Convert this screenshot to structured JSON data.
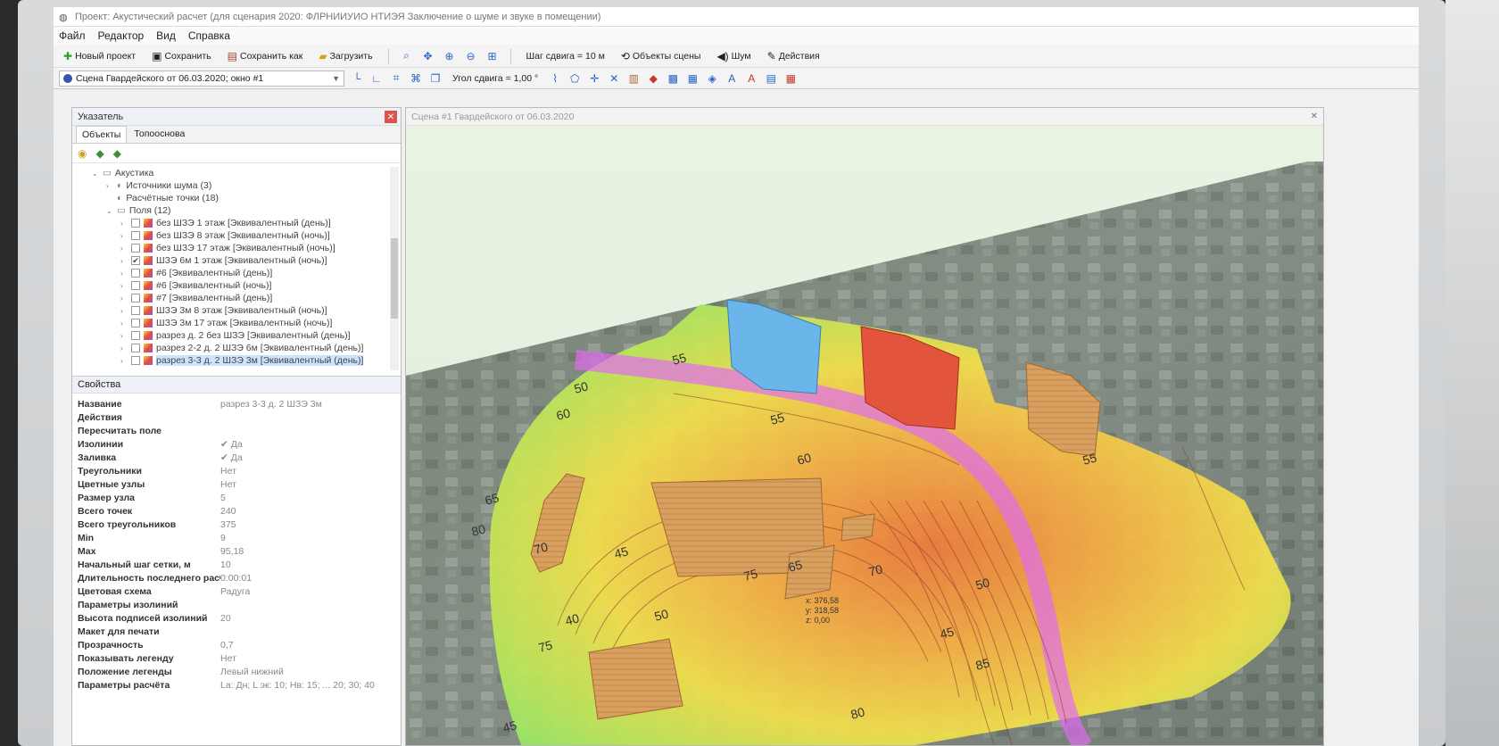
{
  "window": {
    "title": "Проект: Акустический расчет (для сценария 2020: ФЛРНИИУИО НТИЭЯ Заключение о шуме и звуке в помещении)"
  },
  "menu": [
    "Файл",
    "Редактор",
    "Вид",
    "Справка"
  ],
  "toolbar": {
    "new_project": "Новый проект",
    "save": "Сохранить",
    "save_as": "Сохранить как",
    "load": "Загрузить",
    "grid_step": "Шаг сдвига = 10 м",
    "angle_step": "Угол сдвига = 1,00 °",
    "scene_objects": "Объекты сцены",
    "noise": "Шум",
    "actions": "Действия"
  },
  "scene_selector": {
    "value": "Сцена Гвардейского от 06.03.2020; окно #1"
  },
  "left_panel": {
    "title": "Указатель",
    "tabs": [
      "Объекты",
      "Топооснова"
    ],
    "tree": [
      {
        "level": 1,
        "chev": "⌄",
        "label": "Акустика",
        "type": "folder"
      },
      {
        "level": 2,
        "chev": "›",
        "label": "Источники шума (3)",
        "type": "item"
      },
      {
        "level": 2,
        "chev": "",
        "label": "Расчётные точки (18)",
        "type": "item"
      },
      {
        "level": 2,
        "chev": "⌄",
        "label": "Поля (12)",
        "type": "folder"
      },
      {
        "level": 3,
        "chev": "›",
        "label": "без ШЗЭ 1 этаж [Эквивалентный (день)]",
        "check": false
      },
      {
        "level": 3,
        "chev": "›",
        "label": "без ШЗЭ 8 этаж [Эквивалентный (ночь)]",
        "check": false
      },
      {
        "level": 3,
        "chev": "›",
        "label": "без ШЗЭ 17 этаж [Эквивалентный (ночь)]",
        "check": false
      },
      {
        "level": 3,
        "chev": "›",
        "label": "ШЗЭ 6м 1 этаж [Эквивалентный (ночь)]",
        "check": true
      },
      {
        "level": 3,
        "chev": "›",
        "label": "#6 [Эквивалентный (день)]",
        "check": false
      },
      {
        "level": 3,
        "chev": "›",
        "label": "#6 [Эквивалентный (ночь)]",
        "check": false
      },
      {
        "level": 3,
        "chev": "›",
        "label": "#7 [Эквивалентный (день)]",
        "check": false
      },
      {
        "level": 3,
        "chev": "›",
        "label": "ШЗЭ 3м 8 этаж [Эквивалентный (ночь)]",
        "check": false
      },
      {
        "level": 3,
        "chev": "›",
        "label": "ШЗЭ 3м 17 этаж [Эквивалентный (ночь)]",
        "check": false
      },
      {
        "level": 3,
        "chev": "›",
        "label": "разрез д. 2 без ШЗЭ [Эквивалентный (день)]",
        "check": false
      },
      {
        "level": 3,
        "chev": "›",
        "label": "разрез 2-2 д. 2 ШЗЭ 6м [Эквивалентный (день)]",
        "check": false
      },
      {
        "level": 3,
        "chev": "›",
        "label": "разрез 3-3 д. 2 ШЗЭ 3м [Эквивалентный (день)]",
        "check": false,
        "selected": true
      }
    ],
    "props_title": "Свойства",
    "props": [
      {
        "k": "Название",
        "v": "разрез 3-3 д. 2 ШЗЭ 3м"
      },
      {
        "k": "Действия",
        "v": ""
      },
      {
        "k": "Пересчитать поле",
        "v": ""
      },
      {
        "k": "Изолинии",
        "v": "✔ Да"
      },
      {
        "k": "Заливка",
        "v": "✔ Да"
      },
      {
        "k": "Треугольники",
        "v": "Нет"
      },
      {
        "k": "Цветные узлы",
        "v": "Нет"
      },
      {
        "k": "Размер узла",
        "v": "5"
      },
      {
        "k": "Всего точек",
        "v": "240"
      },
      {
        "k": "Всего треугольников",
        "v": "375"
      },
      {
        "k": "Min",
        "v": "9"
      },
      {
        "k": "Max",
        "v": "95,18"
      },
      {
        "k": "Начальный шаг сетки, м",
        "v": "10"
      },
      {
        "k": "Длительность последнего расчёта",
        "v": "0:00:01"
      },
      {
        "k": "Цветовая схема",
        "v": "Радуга"
      },
      {
        "k": "Параметры изолиний",
        "v": ""
      },
      {
        "k": "Высота подписей изолиний",
        "v": "20"
      },
      {
        "k": "Макет для печати",
        "v": ""
      },
      {
        "k": "Прозрачность",
        "v": "0,7"
      },
      {
        "k": "Показывать легенду",
        "v": "Нет"
      },
      {
        "k": "Положение легенды",
        "v": "Левый нижний"
      },
      {
        "k": "Параметры расчёта",
        "v": "Lа: Дн; L эк: 10; Нв: 15; ... 20; 30; 40"
      }
    ]
  },
  "viewport": {
    "title": "Сцена #1 Гвардейского от 06.03.2020",
    "contour_labels": [
      "50",
      "55",
      "60",
      "65",
      "70",
      "75",
      "80",
      "45",
      "40",
      "45",
      "50",
      "55",
      "60",
      "65",
      "70",
      "75",
      "80",
      "85",
      "45",
      "50",
      "55"
    ],
    "tooltip": [
      "x: 376,58",
      "y: 318,58",
      "z: 0,00"
    ]
  }
}
